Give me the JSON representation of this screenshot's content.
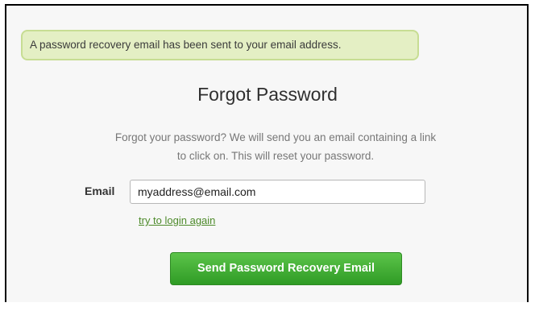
{
  "alert": {
    "message": "A password recovery email has been sent to your email address."
  },
  "form": {
    "title": "Forgot Password",
    "description_line1": "Forgot your password? We will send you an email containing a link",
    "description_line2": "to click on. This will reset your password.",
    "email_label": "Email",
    "email_value": "myaddress@email.com",
    "login_link": "try to login again",
    "submit_label": "Send Password Recovery Email"
  },
  "colors": {
    "alert_background": "#e4efc4",
    "alert_border": "#c7dd93",
    "link": "#4d8a2a",
    "button": "#2f9b25"
  }
}
